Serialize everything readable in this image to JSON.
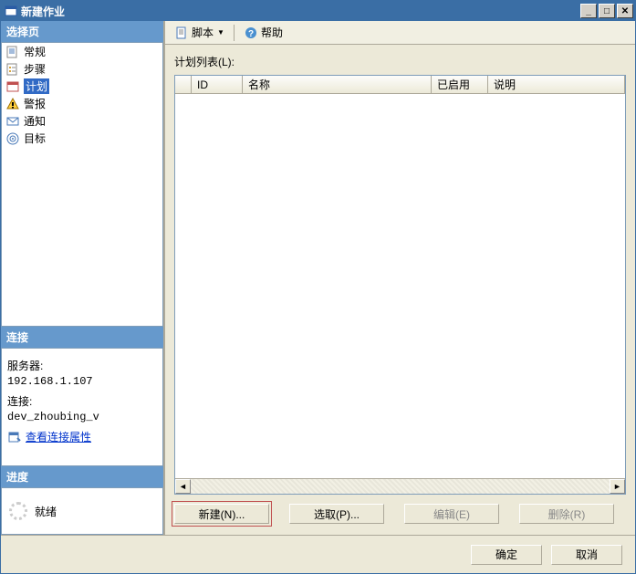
{
  "window": {
    "title": "新建作业"
  },
  "left": {
    "select_header": "选择页",
    "pages": [
      {
        "label": "常规",
        "selected": false
      },
      {
        "label": "步骤",
        "selected": false
      },
      {
        "label": "计划",
        "selected": true
      },
      {
        "label": "警报",
        "selected": false
      },
      {
        "label": "通知",
        "selected": false
      },
      {
        "label": "目标",
        "selected": false
      }
    ],
    "conn_header": "连接",
    "server_label": "服务器:",
    "server_value": "192.168.1.107",
    "conn_label": "连接:",
    "conn_value": "dev_zhoubing_v",
    "view_props": "查看连接属性",
    "progress_header": "进度",
    "progress_status": "就绪"
  },
  "toolbar": {
    "script": "脚本",
    "help": "帮助"
  },
  "main": {
    "list_label": "计划列表(L):",
    "columns": {
      "id": "ID",
      "name": "名称",
      "enabled": "已启用",
      "desc": "说明"
    },
    "buttons": {
      "new": "新建(N)...",
      "pick": "选取(P)...",
      "edit": "编辑(E)",
      "delete": "删除(R)"
    }
  },
  "footer": {
    "ok": "确定",
    "cancel": "取消"
  }
}
